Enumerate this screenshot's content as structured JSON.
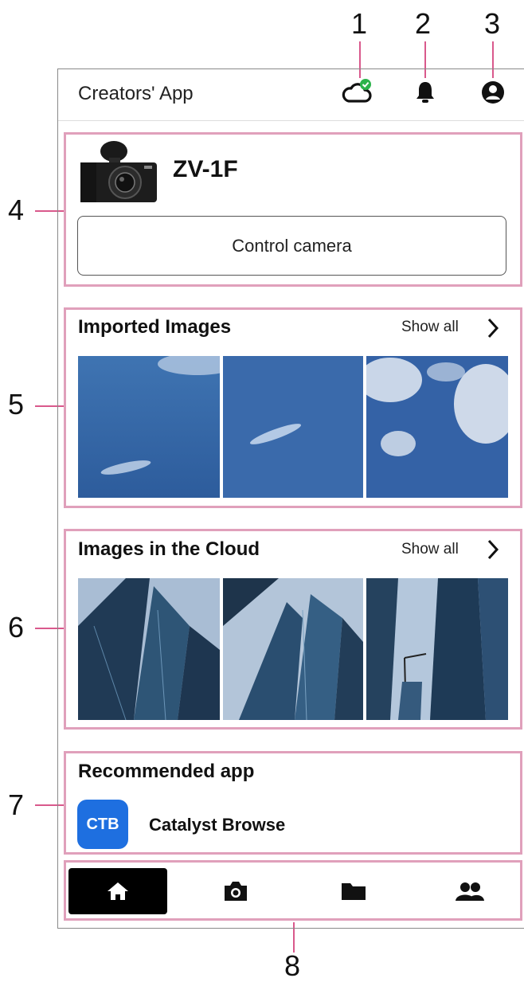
{
  "callouts": [
    "1",
    "2",
    "3",
    "4",
    "5",
    "6",
    "7",
    "8"
  ],
  "header": {
    "title": "Creators' App",
    "icons": [
      "cloud-sync-icon",
      "bell-icon",
      "account-icon"
    ],
    "sync_status_color": "#2bb34a"
  },
  "camera": {
    "model": "ZV-1F",
    "control_button": "Control camera"
  },
  "imported": {
    "title": "Imported Images",
    "show_all": "Show all",
    "thumbnails": [
      "sky-image",
      "sky-image",
      "sky-image"
    ]
  },
  "cloud": {
    "title": "Images in the Cloud",
    "show_all": "Show all",
    "thumbnails": [
      "building-image",
      "building-image",
      "building-image"
    ]
  },
  "recommended": {
    "title": "Recommended app",
    "app_icon_text": "CTB",
    "app_name": "Catalyst Browse",
    "app_icon_color": "#1e6fe0"
  },
  "bottom_nav": {
    "items": [
      "home-icon",
      "camera-icon",
      "folder-icon",
      "people-icon"
    ],
    "active": "home-icon"
  },
  "colors": {
    "callout_highlight": "#e0a0bb",
    "callout_line": "#d9598c"
  }
}
